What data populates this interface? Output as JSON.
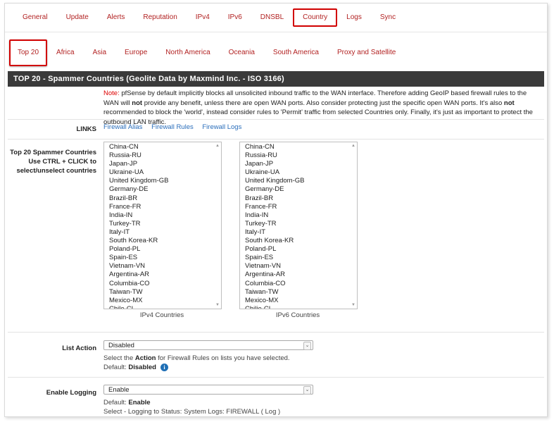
{
  "tabs_primary": [
    "General",
    "Update",
    "Alerts",
    "Reputation",
    "IPv4",
    "IPv6",
    "DNSBL",
    "Country",
    "Logs",
    "Sync"
  ],
  "tabs_primary_active": "Country",
  "tabs_secondary": [
    "Top 20",
    "Africa",
    "Asia",
    "Europe",
    "North America",
    "Oceania",
    "South America",
    "Proxy and Satellite"
  ],
  "tabs_secondary_active": "Top 20",
  "panel": {
    "title": "TOP 20 - Spammer Countries    (Geolite Data by Maxmind Inc. - ISO 3166)"
  },
  "note": {
    "prefix": "Note:",
    "t1": " pfSense by default implicitly blocks all unsolicited inbound traffic to the WAN interface. Therefore adding GeoIP based firewall rules to the WAN will ",
    "b1": "not",
    "t2": " provide any benefit, unless there are open WAN ports. Also consider protecting just the specific open WAN ports. It's also ",
    "b2": "not",
    "t3": " recommended to block the 'world', instead consider rules to 'Permit' traffic from selected Countries only. Finally, it's just as important to protect the outbound LAN traffic."
  },
  "links": {
    "label": "LINKS",
    "items": [
      "Firewall Alias",
      "Firewall Rules",
      "Firewall Logs"
    ]
  },
  "countries": {
    "label": "Top 20 Spammer Countries Use CTRL + CLICK to select/unselect countries",
    "ipv4_caption": "IPv4 Countries",
    "ipv6_caption": "IPv6 Countries",
    "ipv4": [
      "China-CN",
      "Russia-RU",
      "Japan-JP",
      "Ukraine-UA",
      "United Kingdom-GB",
      "Germany-DE",
      "Brazil-BR",
      "France-FR",
      "India-IN",
      "Turkey-TR",
      "Italy-IT",
      "South Korea-KR",
      "Poland-PL",
      "Spain-ES",
      "Vietnam-VN",
      "Argentina-AR",
      "Columbia-CO",
      "Taiwan-TW",
      "Mexico-MX",
      "Chile-CL"
    ],
    "ipv6": [
      "China-CN",
      "Russia-RU",
      "Japan-JP",
      "Ukraine-UA",
      "United Kingdom-GB",
      "Germany-DE",
      "Brazil-BR",
      "France-FR",
      "India-IN",
      "Turkey-TR",
      "Italy-IT",
      "South Korea-KR",
      "Poland-PL",
      "Spain-ES",
      "Vietnam-VN",
      "Argentina-AR",
      "Columbia-CO",
      "Taiwan-TW",
      "Mexico-MX",
      "Chilie-CL"
    ]
  },
  "list_action": {
    "label": "List Action",
    "value": "Disabled",
    "help_pre": "Select the ",
    "help_bold": "Action",
    "help_post": " for Firewall Rules on lists you have selected.",
    "default_label": "Default: ",
    "default_value": "Disabled"
  },
  "enable_logging": {
    "label": "Enable Logging",
    "value": "Enable",
    "default_label": "Default: ",
    "default_value": "Enable",
    "help": "Select - Logging to Status: System Logs: FIREWALL ( Log )"
  },
  "colors": {
    "tab_text": "#b22222",
    "active_border": "#d10000",
    "panel_bg": "#3a3a3a",
    "link": "#2a6ebb",
    "note_red": "#dd0000",
    "info_blue": "#1f6fb5"
  },
  "icons": {
    "info": "info-circle-icon",
    "dropdown": "chevron-down-icon",
    "scroll_up": "scroll-up-icon",
    "scroll_down": "scroll-down-icon"
  }
}
